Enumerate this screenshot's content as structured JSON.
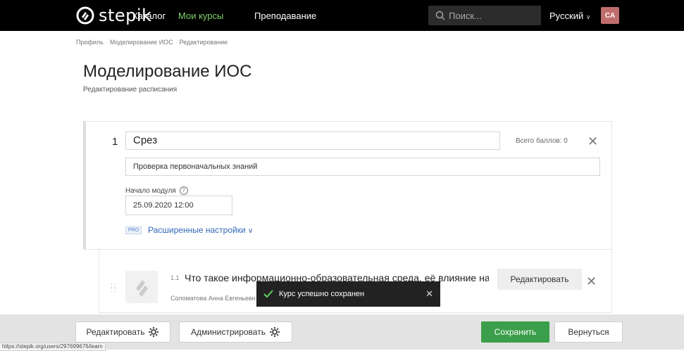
{
  "header": {
    "logo_text": "stepik",
    "nav": [
      "Каталог",
      "Мои курсы",
      "Преподавание"
    ],
    "active_nav": "Мои курсы",
    "search_placeholder": "Поиск...",
    "language": "Русский",
    "avatar_initials": "CA",
    "accent_color": "#7fd26a"
  },
  "breadcrumb": [
    "Профиль",
    "Моделирование ИОС",
    "Редактирование"
  ],
  "page": {
    "title": "Моделирование ИОС",
    "subtitle": "Редактирование расписания"
  },
  "module": {
    "number": "1",
    "title": "Срез",
    "score": "Всего баллов: 0",
    "description": "Проверка первоначальных знаний",
    "start_label": "Начало модуля",
    "start_value": "25.09.2020 12:00",
    "pro_badge": "PRO",
    "advanced_settings": "Расширенные настройки"
  },
  "lesson": {
    "number": "1.1",
    "title": "Что такое информационно-образовательная среда, её влияние на",
    "author": "Соломатова Анна Евгеньевна",
    "edit_label": "Редактировать"
  },
  "toast": {
    "message": "Курс успешно сохранен"
  },
  "footer": {
    "edit_label": "Редактировать",
    "admin_label": "Администрировать",
    "save_label": "Сохранить",
    "back_label": "Вернуться",
    "save_color": "#3b9e4a"
  },
  "status_url": "https://stepik.org/users/297699676/learn"
}
